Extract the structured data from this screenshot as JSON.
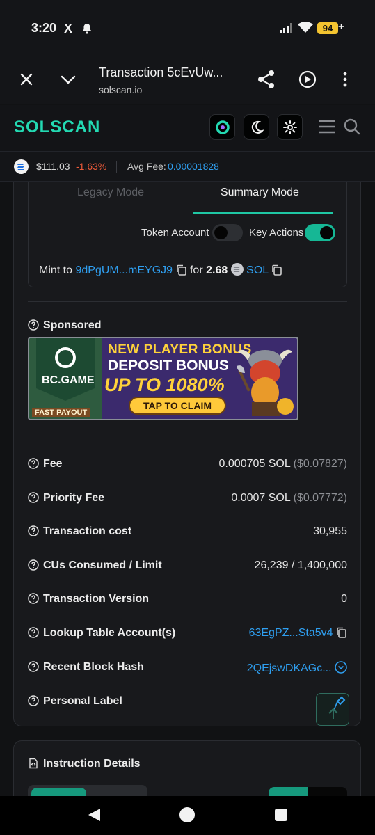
{
  "status_bar": {
    "time": "3:20",
    "x_icon": "X",
    "battery": "94",
    "battery_suffix": "+"
  },
  "browser": {
    "title": "Transaction 5cEvUw...",
    "url": "solscan.io"
  },
  "site": {
    "logo": "SOLSCAN"
  },
  "price_bar": {
    "price": "$111.03",
    "change": "-1.63%",
    "avg_fee_label": "Avg Fee:",
    "avg_fee_value": "0.00001828"
  },
  "tabs": {
    "legacy": "Legacy Mode",
    "summary": "Summary Mode",
    "active": "summary"
  },
  "toggles": {
    "token_account": {
      "label": "Token Account",
      "on": false
    },
    "key_actions": {
      "label": "Key Actions",
      "on": true
    }
  },
  "mint": {
    "prefix": "Mint to",
    "address": "9dPgUM...mEYGJ9",
    "for": "for",
    "amount": "2.68",
    "token": "SOL"
  },
  "sponsored": {
    "label": "Sponsored",
    "banner": {
      "brand": "BC.GAME",
      "line1": "NEW PLAYER BONUS",
      "line2": "DEPOSIT BONUS",
      "line3": "UP TO 1080%",
      "cta": "TAP TO CLAIM",
      "tag": "FAST PAYOUT"
    }
  },
  "details": [
    {
      "label": "Fee",
      "value": "0.000705 SOL",
      "sub": "($0.07827)"
    },
    {
      "label": "Priority Fee",
      "value": "0.0007 SOL",
      "sub": "($0.07772)"
    },
    {
      "label": "Transaction cost",
      "value": "30,955"
    },
    {
      "label": "CUs Consumed / Limit",
      "value": "26,239 / 1,400,000"
    },
    {
      "label": "Transaction Version",
      "value": "0"
    },
    {
      "label": "Lookup Table Account(s)",
      "value": "63EgPZ...Sta5v4"
    },
    {
      "label": "Recent Block Hash",
      "value": "2QEjswDKAGc..."
    },
    {
      "label": "Personal Label",
      "value": ""
    }
  ],
  "instructions": {
    "title": "Instruction Details"
  },
  "colors": {
    "accent": "#1fc7a4",
    "link": "#2f9ff0",
    "negative": "#ef5b3a",
    "logo": "#23d9b2"
  }
}
